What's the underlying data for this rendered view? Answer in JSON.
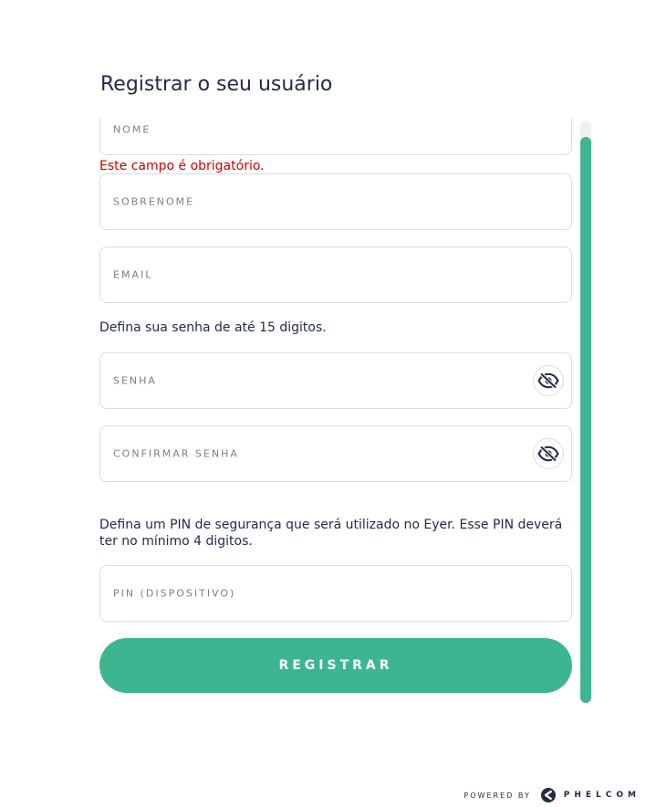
{
  "page": {
    "title": "Registrar o seu usuário"
  },
  "form": {
    "nome": {
      "placeholder": "NOME",
      "value": ""
    },
    "nome_error": "Este campo é obrigatório.",
    "sobrenome": {
      "placeholder": "SOBRENOME",
      "value": ""
    },
    "email": {
      "placeholder": "EMAIL",
      "value": ""
    },
    "password_hint": "Defina sua senha de até 15 digitos.",
    "senha": {
      "placeholder": "SENHA",
      "value": "",
      "toggle_icon": "eye-slash-icon"
    },
    "confirmar_senha": {
      "placeholder": "CONFIRMAR SENHA",
      "value": "",
      "toggle_icon": "eye-slash-icon"
    },
    "pin_hint": "Defina um PIN de segurança que será utilizado no Eyer. Esse PIN deverá ter no mínimo 4 digitos.",
    "pin": {
      "placeholder": "PIN (DISPOSITIVO)",
      "value": ""
    },
    "submit_label": "REGISTRAR"
  },
  "footer": {
    "powered_by": "POWERED BY",
    "brand": "PHELCOM",
    "brand_icon": "phelcom-logo-icon"
  },
  "colors": {
    "accent": "#3db590",
    "error": "#d00000",
    "text": "#1f2a44",
    "border": "#d9dde2"
  }
}
